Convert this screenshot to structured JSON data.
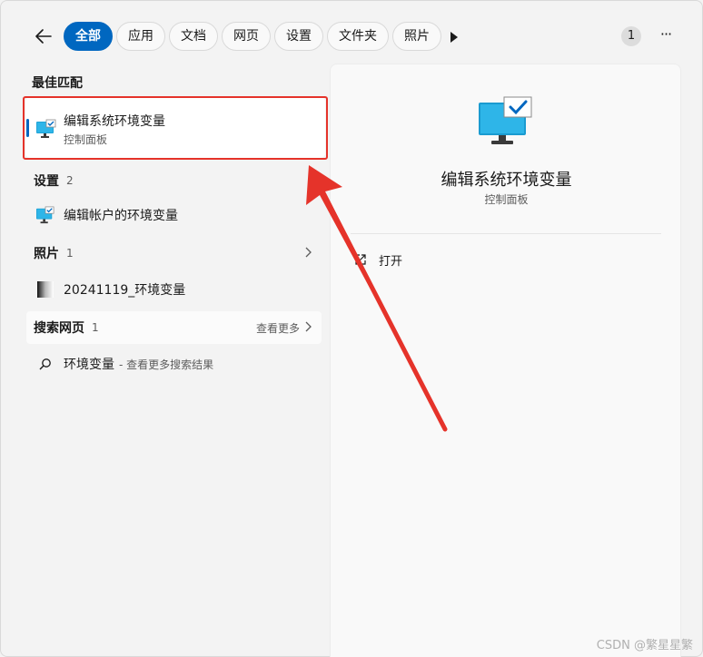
{
  "filters": {
    "chips": [
      "全部",
      "应用",
      "文档",
      "网页",
      "设置",
      "文件夹",
      "照片"
    ],
    "active_index": 0,
    "notification_count": "1",
    "menu_label": "···"
  },
  "best_match": {
    "header": "最佳匹配",
    "title": "编辑系统环境变量",
    "subtitle": "控制面板"
  },
  "settings": {
    "header": "设置",
    "count": "2",
    "items": [
      "编辑帐户的环境变量"
    ]
  },
  "photos": {
    "header": "照片",
    "count": "1",
    "items": [
      "20241119_环境变量"
    ]
  },
  "web": {
    "header": "搜索网页",
    "count": "1",
    "see_more": "查看更多",
    "query": "环境变量",
    "query_suffix": "- 查看更多搜索结果"
  },
  "detail": {
    "title": "编辑系统环境变量",
    "subtitle": "控制面板",
    "actions": [
      "打开"
    ]
  },
  "watermark": "CSDN @繁星星繁",
  "colors": {
    "accent": "#0067c0",
    "highlight": "#e5332a",
    "monitor": "#1fa3d7"
  }
}
